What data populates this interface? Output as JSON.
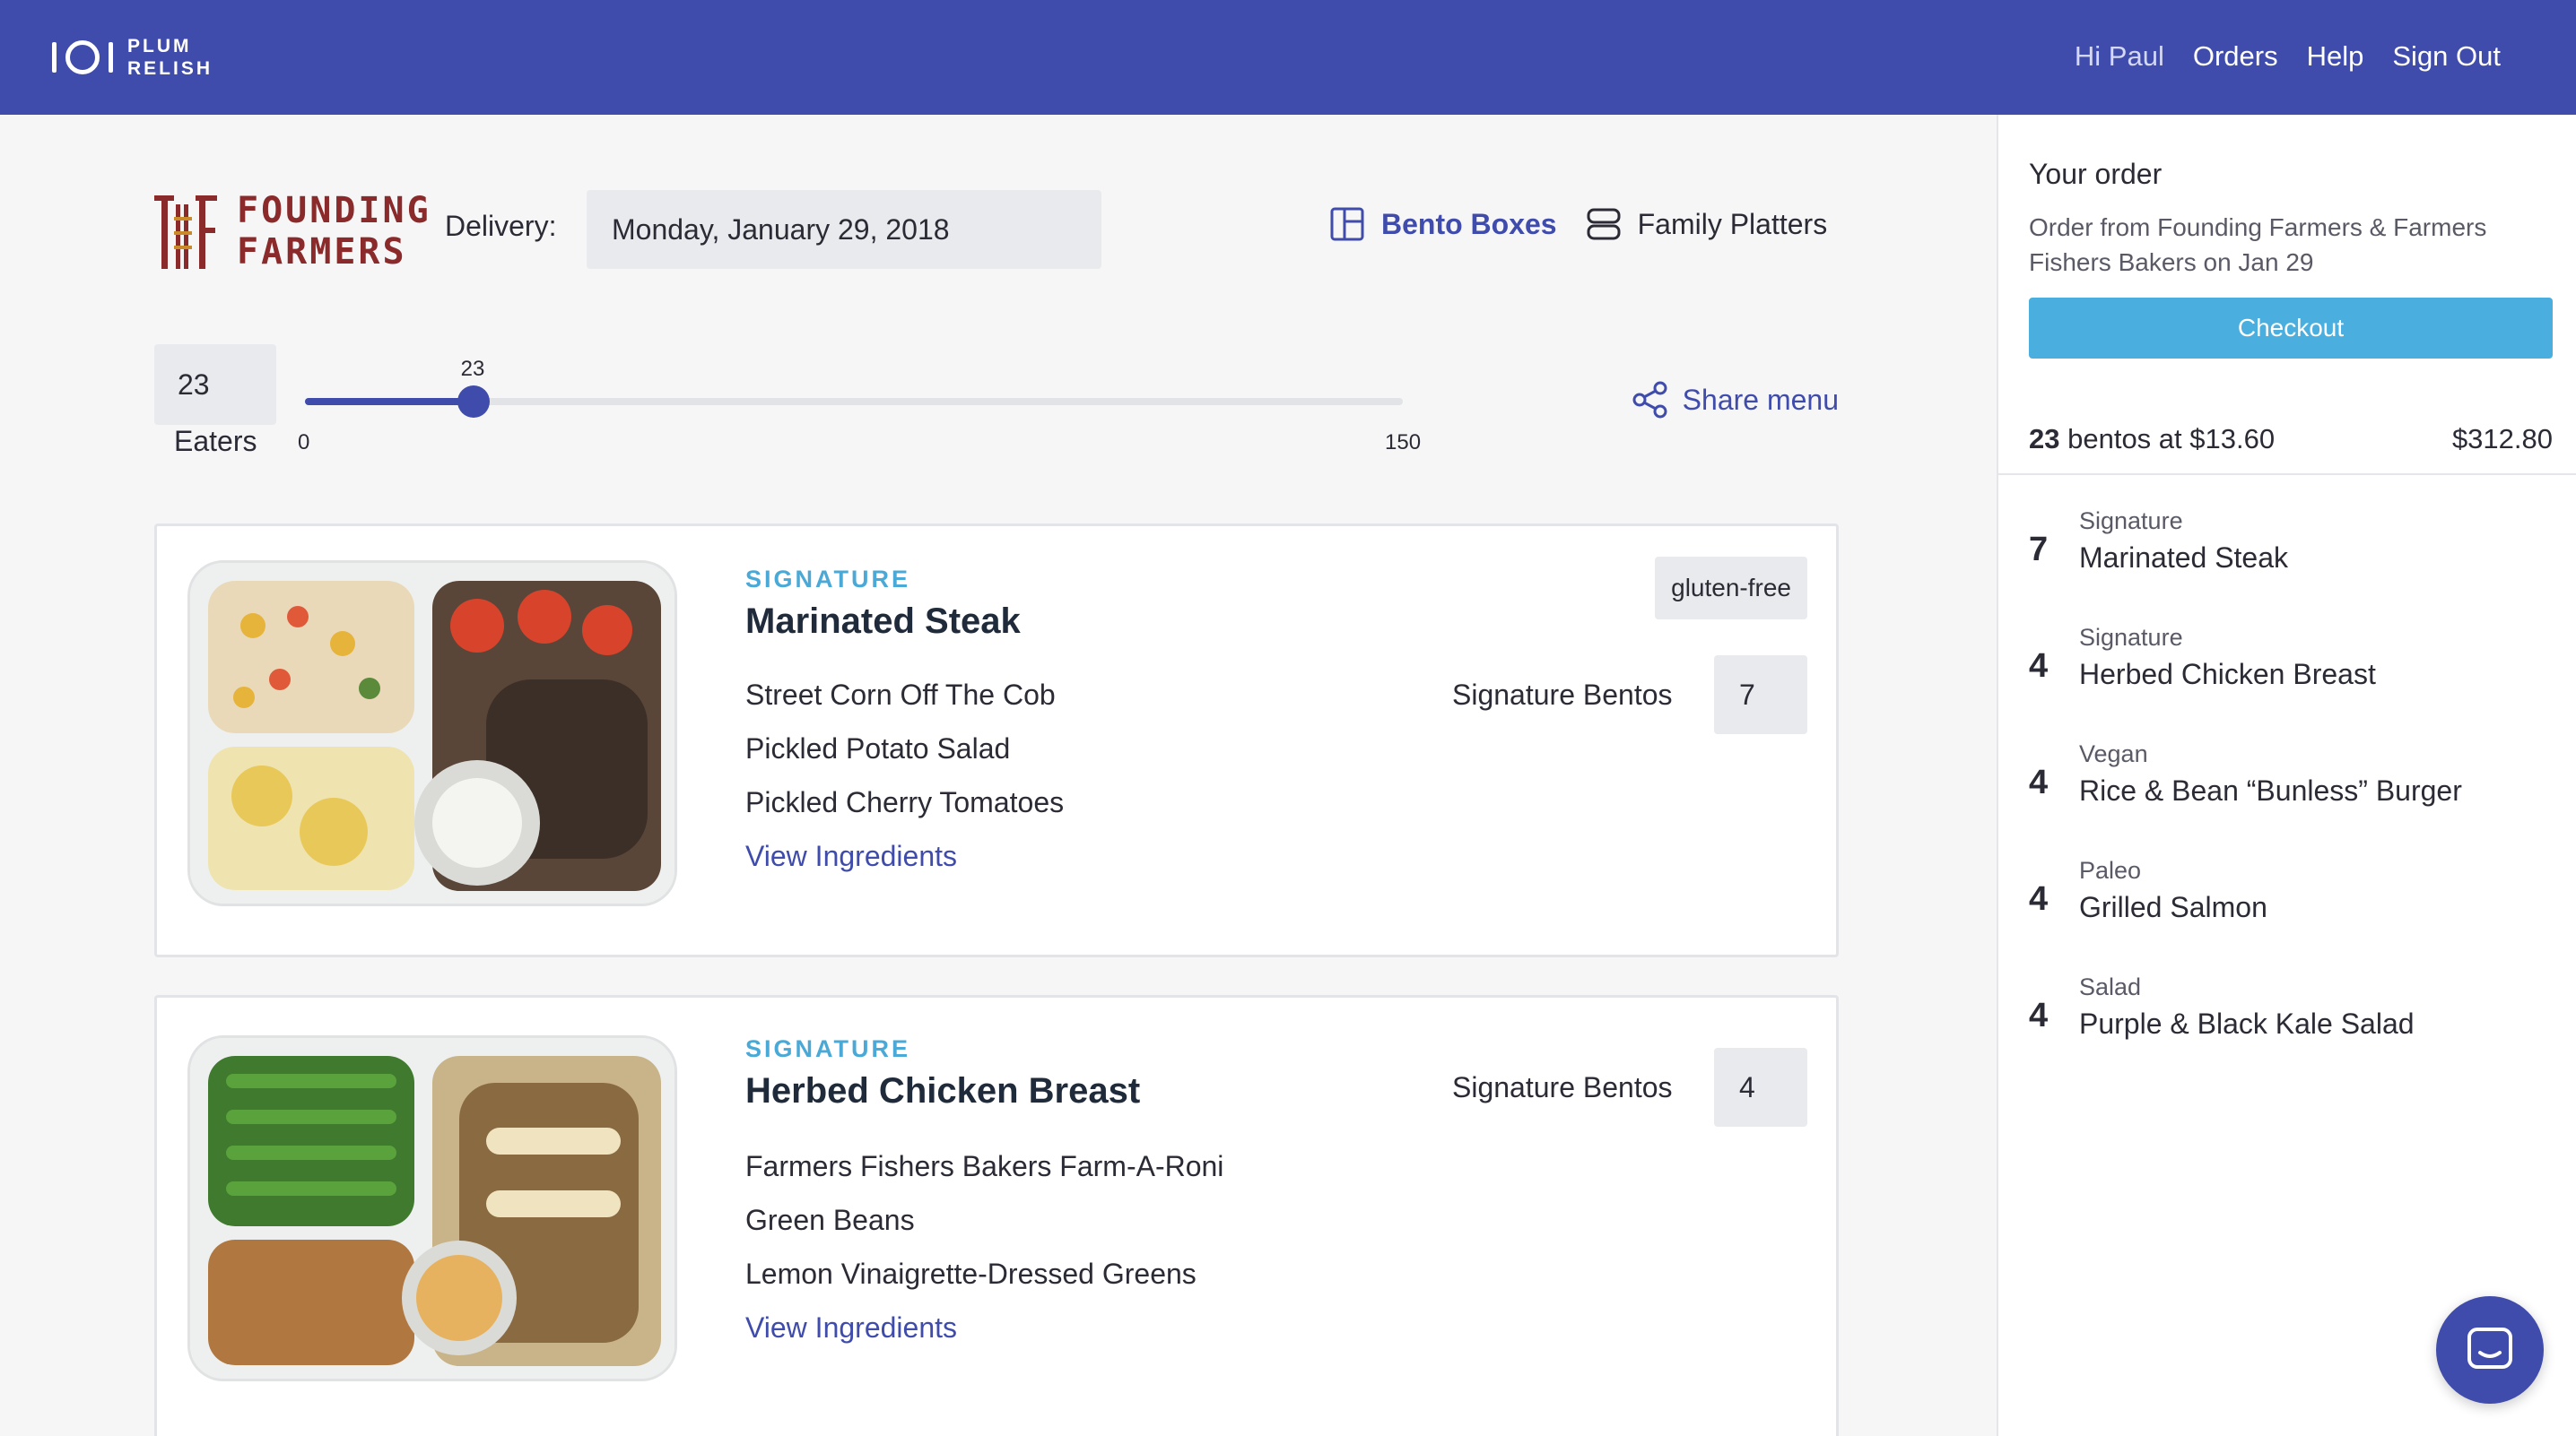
{
  "header": {
    "brand_line1": "PLUM",
    "brand_line2": "RELISH",
    "greeting": "Hi Paul",
    "nav": [
      "Orders",
      "Help",
      "Sign Out"
    ]
  },
  "restaurant": {
    "logo_line1": "FOUNDING",
    "logo_line2": "FARMERS"
  },
  "delivery": {
    "label": "Delivery:",
    "date": "Monday, January 29, 2018"
  },
  "mode_tabs": [
    {
      "label": "Bento Boxes",
      "active": true,
      "icon": "bento-box-icon"
    },
    {
      "label": "Family Platters",
      "active": false,
      "icon": "platter-icon"
    }
  ],
  "eaters": {
    "value": "23",
    "label": "Eaters",
    "slider_value": 23,
    "slider_min": 0,
    "slider_max": 150,
    "slider_value_label": "23",
    "slider_min_label": "0",
    "slider_max_label": "150"
  },
  "share_menu": "Share menu",
  "meals": [
    {
      "category": "SIGNATURE",
      "name": "Marinated Steak",
      "tag": "gluten-free",
      "sides": [
        "Street Corn Off The Cob",
        "Pickled Potato Salad",
        "Pickled Cherry Tomatoes"
      ],
      "view_ingredients": "View Ingredients",
      "qty_label": "Signature Bentos",
      "qty": "7"
    },
    {
      "category": "SIGNATURE",
      "name": "Herbed Chicken Breast",
      "tag": "",
      "sides": [
        "Farmers Fishers Bakers Farm-A-Roni",
        "Green Beans",
        "Lemon Vinaigrette-Dressed Greens"
      ],
      "view_ingredients": "View Ingredients",
      "qty_label": "Signature Bentos",
      "qty": "4"
    }
  ],
  "order": {
    "title": "Your order",
    "description": "Order from Founding Farmers & Farmers Fishers Bakers on Jan 29",
    "checkout": "Checkout",
    "summary_count": "23",
    "summary_text": "bentos at $13.60",
    "summary_total": "$312.80",
    "items": [
      {
        "count": "7",
        "category": "Signature",
        "name": "Marinated Steak"
      },
      {
        "count": "4",
        "category": "Signature",
        "name": "Herbed Chicken Breast"
      },
      {
        "count": "4",
        "category": "Vegan",
        "name": "Rice & Bean “Bunless” Burger"
      },
      {
        "count": "4",
        "category": "Paleo",
        "name": "Grilled Salmon"
      },
      {
        "count": "4",
        "category": "Salad",
        "name": "Purple & Black Kale Salad"
      }
    ]
  },
  "colors": {
    "primary": "#3f4cab",
    "accent": "#4aa9d6",
    "checkout": "#4aaedf",
    "ff_red": "#8a2a2a"
  }
}
